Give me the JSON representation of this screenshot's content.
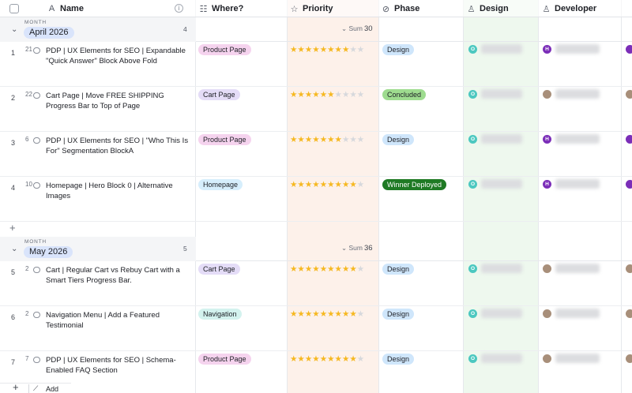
{
  "columns": {
    "name": "Name",
    "where": "Where?",
    "priority": "Priority",
    "phase": "Phase",
    "design": "Design",
    "developer": "Developer"
  },
  "groups": [
    {
      "month_label": "MONTH",
      "title": "April 2026",
      "count": "4",
      "sum_label": "Sum",
      "sum_value": "30"
    },
    {
      "month_label": "MONTH",
      "title": "May 2026",
      "count": "5",
      "sum_label": "Sum",
      "sum_value": "36"
    }
  ],
  "rows": [
    {
      "num": "1",
      "comments": "21",
      "name": "PDP | UX Elements for SEO | Expandable \"Quick Answer\" Block Above Fold",
      "where": "Product Page",
      "where_bg": "#f5d3ee",
      "stars": 8,
      "phase": "Design",
      "phase_bg": "#cfe6fb",
      "phase_fg": "#1d1f25",
      "design_initial": "O",
      "design_color": "#4cc8c0",
      "dev_initial": "H",
      "dev_color": "#7b2eb8"
    },
    {
      "num": "2",
      "comments": "22",
      "name": "Cart Page | Move FREE SHIPPING Progress Bar to Top of Page",
      "where": "Cart Page",
      "where_bg": "#e4dcf7",
      "stars": 6,
      "phase": "Concluded",
      "phase_bg": "#9edc8f",
      "phase_fg": "#1d1f25",
      "design_initial": "O",
      "design_color": "#4cc8c0",
      "dev_initial": "",
      "dev_color": "#a88f7a"
    },
    {
      "num": "3",
      "comments": "6",
      "name": "PDP | UX Elements for SEO | \"Who This Is For\" Segmentation BlockA",
      "where": "Product Page",
      "where_bg": "#f5d3ee",
      "stars": 7,
      "phase": "Design",
      "phase_bg": "#cfe6fb",
      "phase_fg": "#1d1f25",
      "design_initial": "O",
      "design_color": "#4cc8c0",
      "dev_initial": "H",
      "dev_color": "#7b2eb8"
    },
    {
      "num": "4",
      "comments": "10",
      "name": "Homepage | Hero Block 0 | Alternative Images",
      "where": "Homepage",
      "where_bg": "#d6eefc",
      "stars": 9,
      "phase": "Winner Deployed",
      "phase_bg": "#1f7a24",
      "phase_fg": "#ffffff",
      "design_initial": "O",
      "design_color": "#4cc8c0",
      "dev_initial": "H",
      "dev_color": "#7b2eb8"
    },
    {
      "num": "5",
      "comments": "2",
      "name": "Cart | Regular Cart vs Rebuy Cart with a Smart Tiers Progress Bar.",
      "where": "Cart Page",
      "where_bg": "#e4dcf7",
      "stars": 9,
      "phase": "Design",
      "phase_bg": "#cfe6fb",
      "phase_fg": "#1d1f25",
      "design_initial": "O",
      "design_color": "#4cc8c0",
      "dev_initial": "",
      "dev_color": "#a88f7a"
    },
    {
      "num": "6",
      "comments": "2",
      "name": "Navigation Menu | Add a Featured Testimonial",
      "where": "Navigation",
      "where_bg": "#d3f2ee",
      "stars": 9,
      "phase": "Design",
      "phase_bg": "#cfe6fb",
      "phase_fg": "#1d1f25",
      "design_initial": "O",
      "design_color": "#4cc8c0",
      "dev_initial": "",
      "dev_color": "#a88f7a"
    },
    {
      "num": "7",
      "comments": "7",
      "name": "PDP | UX Elements for SEO | Schema-Enabled FAQ Section",
      "where": "Product Page",
      "where_bg": "#f5d3ee",
      "stars": 9,
      "phase": "Design",
      "phase_bg": "#cfe6fb",
      "phase_fg": "#1d1f25",
      "design_initial": "O",
      "design_color": "#4cc8c0",
      "dev_initial": "",
      "dev_color": "#a88f7a"
    }
  ],
  "stars_total": 10,
  "icons": {
    "name": "text-a-icon",
    "where": "multi-select-icon",
    "priority": "star-icon",
    "phase": "status-circle-icon",
    "design": "person-icon",
    "developer": "person-icon"
  },
  "footer": {
    "add_label": "Add"
  },
  "colors": {
    "priority_col": "#fdf1ea",
    "design_col": "#eef8ee",
    "star_on": "#f6b820",
    "star_off": "#d6d8dc",
    "group_pill": "#d9e4fb"
  }
}
